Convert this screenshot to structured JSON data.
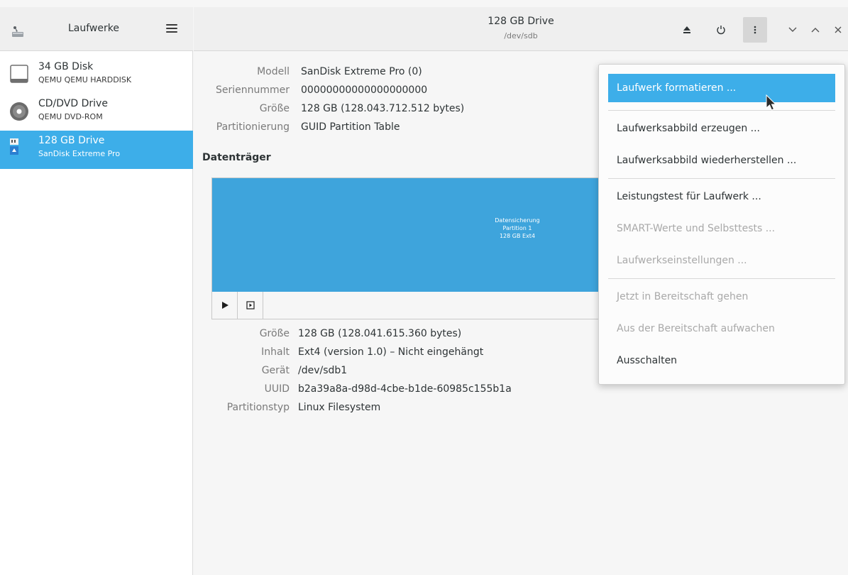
{
  "sidebar": {
    "title": "Laufwerke",
    "drives": [
      {
        "name": "34 GB Disk",
        "model": "QEMU QEMU HARDDISK",
        "icon": "harddisk-icon"
      },
      {
        "name": "CD/DVD Drive",
        "model": "QEMU DVD-ROM",
        "icon": "optical-disc-icon"
      },
      {
        "name": "128 GB Drive",
        "model": "SanDisk Extreme Pro",
        "icon": "flash-drive-icon",
        "selected": true
      }
    ]
  },
  "header": {
    "title": "128 GB Drive",
    "subtitle": "/dev/sdb"
  },
  "drive_info": {
    "model_label": "Modell",
    "model_value": "SanDisk Extreme Pro (0)",
    "serial_label": "Seriennummer",
    "serial_value": "00000000000000000000",
    "size_label": "Größe",
    "size_value": "128 GB (128.043.712.512 bytes)",
    "partitioning_label": "Partitionierung",
    "partitioning_value": "GUID Partition Table"
  },
  "volumes": {
    "title": "Datenträger",
    "partition": {
      "line1": "Datensicherung",
      "line2": "Partition 1",
      "line3": "128 GB Ext4"
    }
  },
  "partition_info": {
    "size_label": "Größe",
    "size_value": "128 GB (128.041.615.360 bytes)",
    "content_label": "Inhalt",
    "content_value": "Ext4 (version 1.0) – Nicht eingehängt",
    "device_label": "Gerät",
    "device_value": "/dev/sdb1",
    "uuid_label": "UUID",
    "uuid_value": "b2a39a8a-d98d-4cbe-b1de-60985c155b1a",
    "type_label": "Partitionstyp",
    "type_value": "Linux Filesystem"
  },
  "menu": {
    "format": "Laufwerk formatieren ...",
    "create_image": "Laufwerksabbild erzeugen ...",
    "restore_image": "Laufwerksabbild wiederherstellen ...",
    "benchmark": "Leistungstest für Laufwerk ...",
    "smart": "SMART-Werte und Selbsttests ...",
    "settings": "Laufwerkseinstellungen ...",
    "standby": "Jetzt in Bereitschaft gehen",
    "wakeup": "Aus der Bereitschaft aufwachen",
    "poweroff": "Ausschalten"
  },
  "colors": {
    "accent": "#3daee9",
    "partition": "#3ea4dc"
  }
}
